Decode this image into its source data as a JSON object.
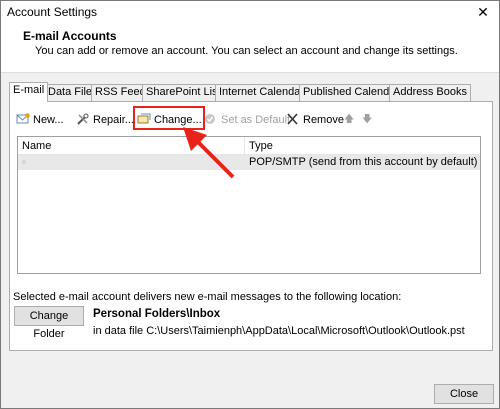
{
  "window": {
    "title": "Account Settings"
  },
  "header": {
    "title": "E-mail Accounts",
    "description": "You can add or remove an account. You can select an account and change its settings."
  },
  "tabs": [
    {
      "label": "E-mail",
      "active": true
    },
    {
      "label": "Data Files"
    },
    {
      "label": "RSS Feeds"
    },
    {
      "label": "SharePoint Lists"
    },
    {
      "label": "Internet Calendars"
    },
    {
      "label": "Published Calendars"
    },
    {
      "label": "Address Books"
    }
  ],
  "toolbar": {
    "new_label": "New...",
    "repair_label": "Repair...",
    "change_label": "Change...",
    "set_default_label": "Set as Default",
    "remove_label": "Remove"
  },
  "list": {
    "columns": {
      "name": "Name",
      "type": "Type"
    },
    "rows": [
      {
        "name": "",
        "type": "POP/SMTP (send from this account by default)"
      }
    ]
  },
  "location": {
    "description": "Selected e-mail account delivers new e-mail messages to the following location:",
    "change_folder_label": "Change Folder",
    "folder_name": "Personal Folders\\Inbox",
    "folder_path": "in data file C:\\Users\\Taimienph\\AppData\\Local\\Microsoft\\Outlook\\Outlook.pst"
  },
  "footer": {
    "close_label": "Close"
  },
  "colors": {
    "annotation_red": "#e8231c"
  }
}
